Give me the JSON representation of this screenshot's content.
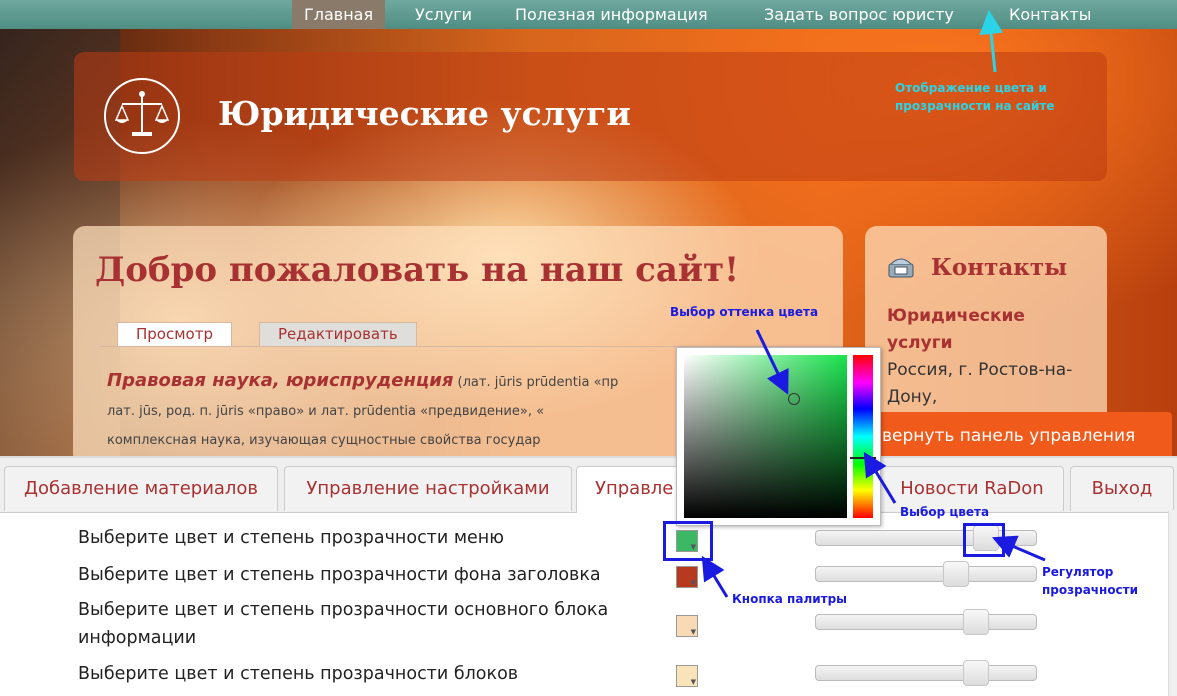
{
  "top_menu": {
    "items": [
      {
        "label": "Главная"
      },
      {
        "label": "Услуги"
      },
      {
        "label": "Полезная информация"
      },
      {
        "label": "Задать вопрос юристу"
      },
      {
        "label": "Контакты"
      }
    ]
  },
  "header": {
    "site_title": "Юридические услуги"
  },
  "main": {
    "welcome": "Добро пожаловать на наш сайт!",
    "tabs": [
      {
        "label": "Просмотр"
      },
      {
        "label": "Редактировать"
      }
    ],
    "article": {
      "lead": "Правовая наука, юриспруденция",
      "line1": " (лат. jūris prūdentia «пр",
      "line2": "лат. jūs, род. п. jūris «право» и лат. prūdentia «предвидение», «",
      "line3": "комплексная наука, изучающая сущностные свойства государ"
    }
  },
  "contacts": {
    "title": "Контакты",
    "company": "Юридические услуги",
    "address": "Россия, г. Ростов-на-Дону,"
  },
  "return_button": "вернуть панель управления",
  "panel": {
    "tabs": [
      {
        "label": "Добавление материалов"
      },
      {
        "label": "Управление настройками"
      },
      {
        "label": "Управле"
      },
      {
        "label": "Новости RaDon"
      },
      {
        "label": "Выход"
      }
    ],
    "rows": [
      {
        "label": "Выберите цвет и степень прозрачности меню",
        "color": "#3cb864",
        "opacity": 0.8
      },
      {
        "label": "Выберите цвет и степень прозрачности фона заголовка",
        "color": "#b53a20",
        "opacity": 0.65
      },
      {
        "label": "Выберите цвет и степень прозрачности основного блока информации",
        "color": "#f8dab4",
        "opacity": 0.75
      },
      {
        "label": "Выберите цвет и степень прозрачности блоков",
        "color": "#f8e4b8",
        "opacity": 0.75
      }
    ]
  },
  "annotations": {
    "site_display": "Отображение цвета и прозрачности на сайте",
    "shade": "Выбор оттенка цвета",
    "hue": "Выбор цвета",
    "slider": "Регулятор прозрачности",
    "palette_button": "Кнопка палитры"
  }
}
